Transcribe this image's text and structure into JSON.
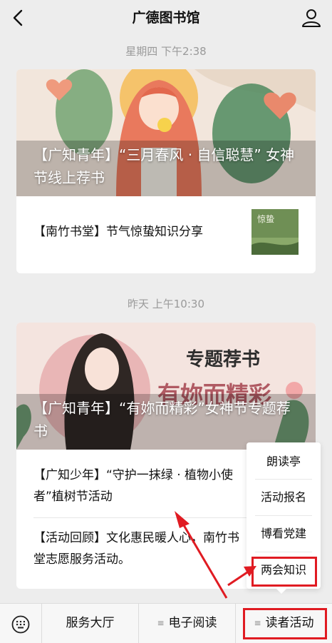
{
  "header": {
    "title": "广德图书馆"
  },
  "messages": [
    {
      "timestamp": "星期四 下午2:38",
      "cover_title": "【广知青年】“三月春风 · 自信聪慧” 女神节线上荐书",
      "items": [
        {
          "text": "【南竹书堂】节气惊蛰知识分享",
          "thumb_text": "惊蛰"
        }
      ]
    },
    {
      "timestamp": "昨天 上午10:30",
      "cover_title": "【广知青年】“有妳而精彩”女神节专题荐书",
      "cover_caption": "专题荐书",
      "cover_caption2": "有妳而精彩",
      "items": [
        {
          "text": "【广知少年】“守护一抹绿 · 植物小使者”植树节活动"
        },
        {
          "text": "【活动回顾】文化惠民暖人心，南竹书堂志愿服务活动。"
        }
      ]
    }
  ],
  "popup_menu": {
    "items": [
      "朗读亭",
      "活动报名",
      "博看党建",
      "两会知识"
    ]
  },
  "bottom_menu": {
    "tabs": [
      "服务大厅",
      "电子阅读",
      "读者活动"
    ]
  },
  "colors": {
    "highlight": "#e01b22",
    "background": "#ededed"
  }
}
